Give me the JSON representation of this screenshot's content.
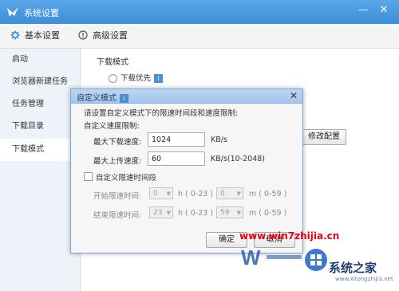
{
  "window": {
    "title": "系统设置",
    "minimize": "—",
    "close": "✕"
  },
  "tabs": [
    {
      "label": "基本设置",
      "icon": "gear-icon"
    },
    {
      "label": "高级设置",
      "icon": "info-circle-icon"
    }
  ],
  "sidebar": {
    "items": [
      {
        "label": "启动"
      },
      {
        "label": "浏览器新建任务"
      },
      {
        "label": "任务管理"
      },
      {
        "label": "下载目录"
      },
      {
        "label": "下载模式",
        "active": true
      }
    ]
  },
  "main": {
    "section_title": "下载模式",
    "option_priority": "下载优先",
    "modify_config_button": "修改配置"
  },
  "dialog": {
    "title": "自定义模式",
    "description": "请设置自定义模式下的限速时间段和速度限制:",
    "speed_limit_heading": "自定义速度限制:",
    "max_download_label": "最大下载速度:",
    "max_download_value": "1024",
    "max_download_unit": "KB/s",
    "max_upload_label": "最大上传速度:",
    "max_upload_value": "60",
    "max_upload_unit": "KB/s(10-2048)",
    "custom_period_label": "自定义限速时间段",
    "start_label": "开始限速时间:",
    "start_hour": "0",
    "start_minute": "0",
    "end_label": "结束限速时间:",
    "end_hour": "23",
    "end_minute": "59",
    "hour_unit": "h ( 0-23 )",
    "minute_unit": "m ( 0-59 )",
    "ok_button": "确定",
    "cancel_button": "取消"
  },
  "watermark": {
    "url": "www.win7zhijia.cn",
    "brand": "系统之家",
    "sub": "www.xitongzhijia.net"
  },
  "colors": {
    "titlebar": "#3c8fda",
    "dialog_title": "#a4c5ec",
    "watermark_red": "#e60012",
    "accent_blue": "#4a90d9"
  }
}
